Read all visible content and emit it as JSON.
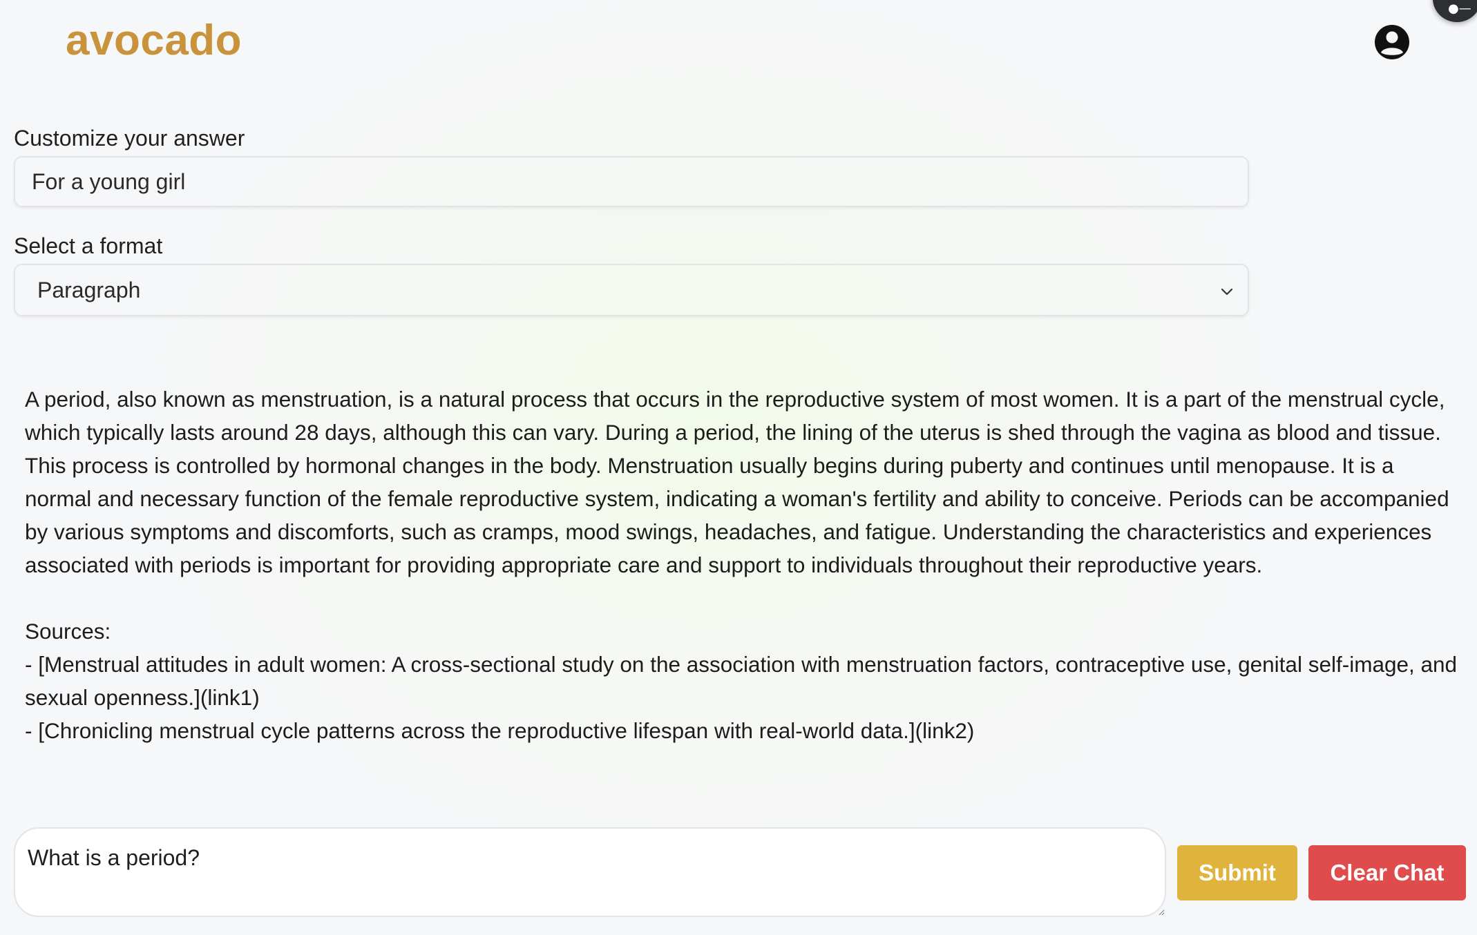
{
  "header": {
    "logo_text": "avocado",
    "user_icon": "user-circle-icon"
  },
  "customize": {
    "label": "Customize your answer",
    "value": "For a young girl"
  },
  "format": {
    "label": "Select a format",
    "selected": "Paragraph"
  },
  "answer": {
    "paragraph": "A period, also known as menstruation, is a natural process that occurs in the reproductive system of most women. It is a part of the menstrual cycle, which typically lasts around 28 days, although this can vary. During a period, the lining of the uterus is shed through the vagina as blood and tissue. This process is controlled by hormonal changes in the body. Menstruation usually begins during puberty and continues until menopause. It is a normal and necessary function of the female reproductive system, indicating a woman's fertility and ability to conceive. Periods can be accompanied by various symptoms and discomforts, such as cramps, mood swings, headaches, and fatigue. Understanding the characteristics and experiences associated with periods is important for providing appropriate care and support to individuals throughout their reproductive years.",
    "sources_label": "Sources:",
    "sources": [
      "- [Menstrual attitudes in adult women: A cross-sectional study on the association with menstruation factors, contraceptive use, genital self-image, and sexual openness.](link1)",
      "- [Chronicling menstrual cycle patterns across the reproductive lifespan with real-world data.](link2)"
    ]
  },
  "chat": {
    "input_value": "What is a period?",
    "submit_label": "Submit",
    "clear_label": "Clear Chat"
  },
  "colors": {
    "logo": "#c8933a",
    "submit": "#e0b33d",
    "clear": "#e04b4b"
  }
}
